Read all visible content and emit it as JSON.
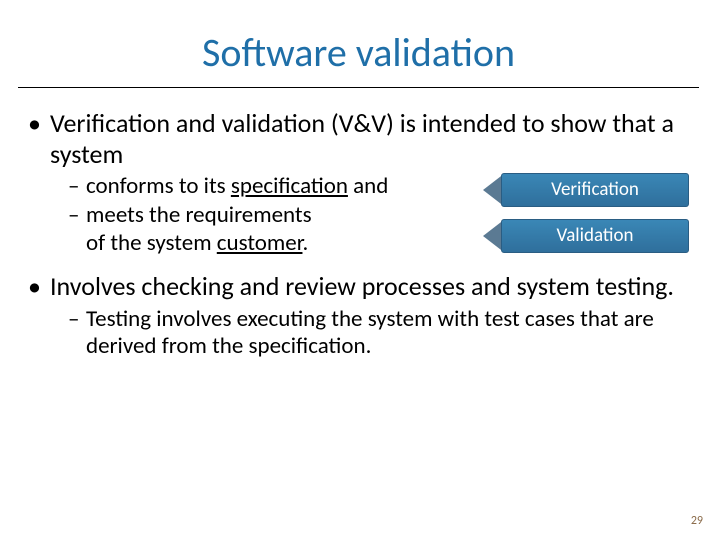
{
  "title": "Software validation",
  "bullets": {
    "b1": "Verification and validation (V&V) is intended to show that a system",
    "b1_sub1_pre": "conforms to its ",
    "b1_sub1_u": "specification",
    "b1_sub1_post": " and",
    "b1_sub2_line1": "meets the requirements",
    "b1_sub2_line2_pre": "of the system ",
    "b1_sub2_line2_u": "customer",
    "b1_sub2_line2_post": ".",
    "b2": "Involves checking and review processes and system testing.",
    "b2_sub1": "Testing involves executing the system with test cases that are derived from the specification."
  },
  "tags": {
    "verification": "Verification",
    "validation": "Validation"
  },
  "page_number": "29"
}
